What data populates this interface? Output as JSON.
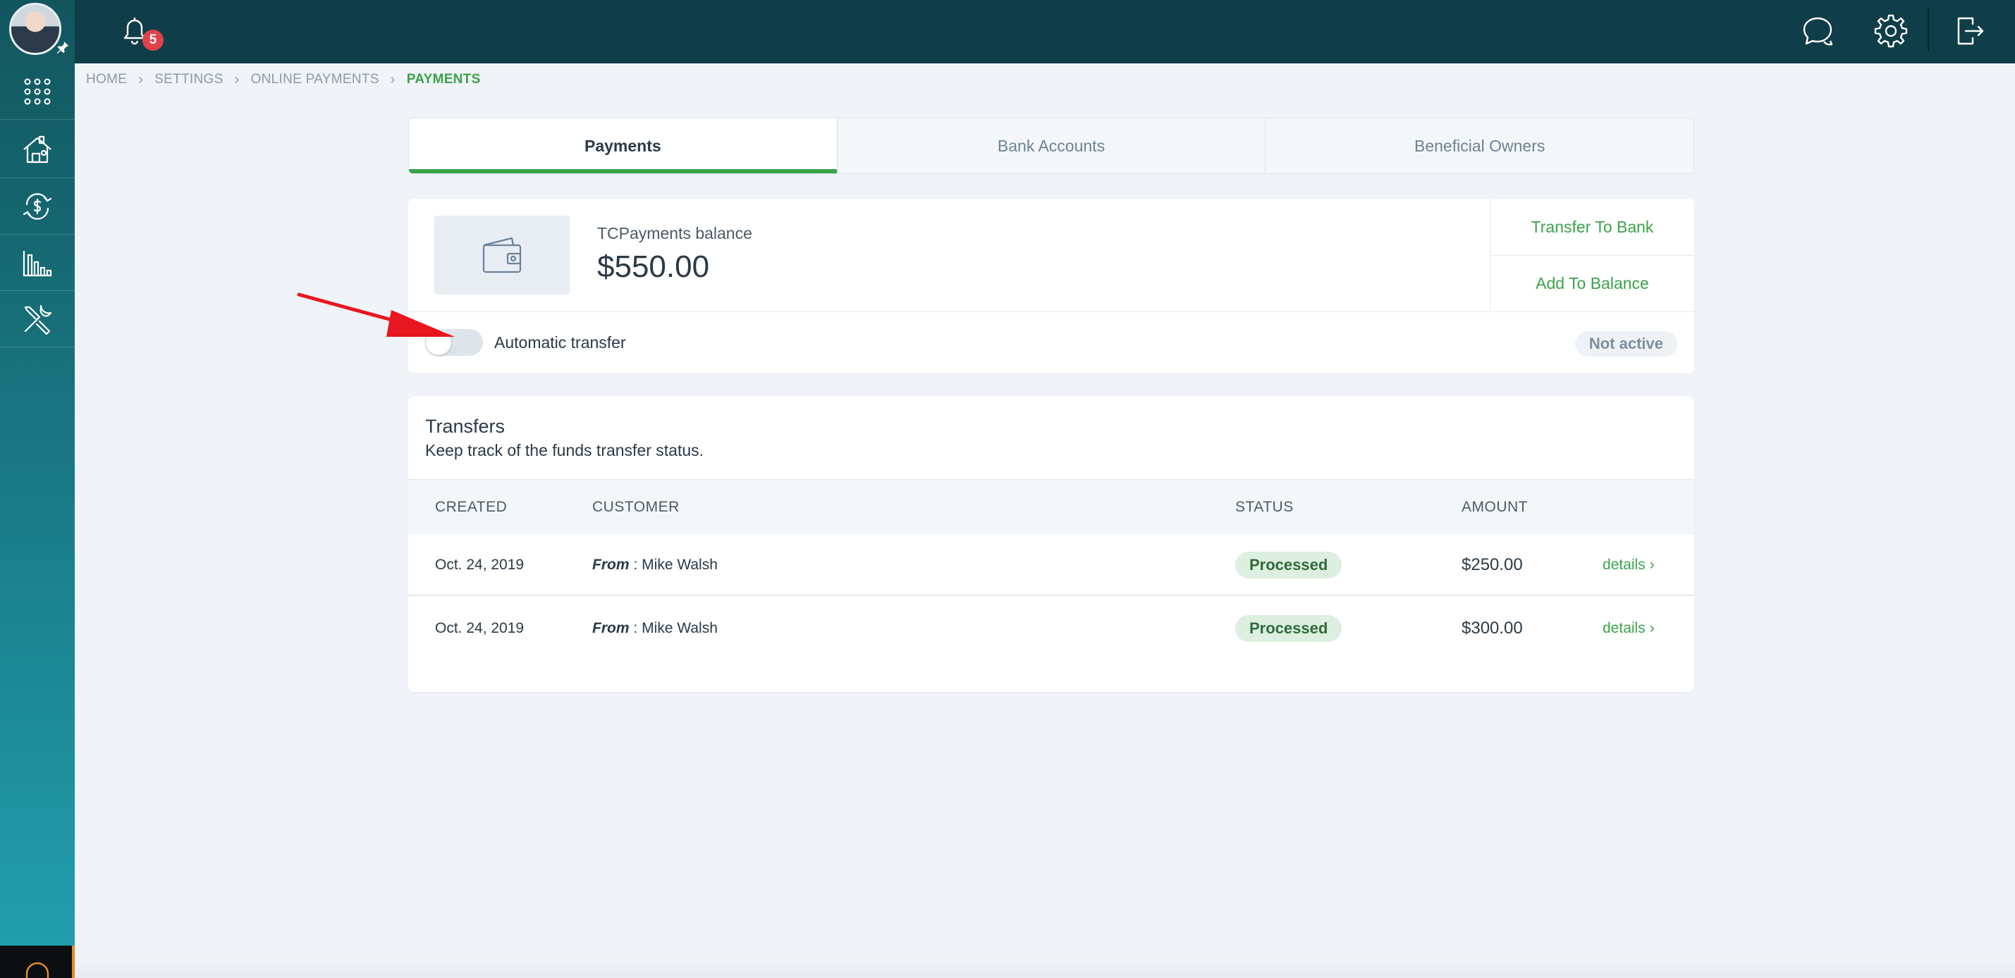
{
  "topbar": {
    "notification_count": "5"
  },
  "breadcrumb": {
    "items": [
      "HOME",
      "SETTINGS",
      "ONLINE PAYMENTS",
      "PAYMENTS"
    ]
  },
  "tabs": [
    {
      "label": "Payments",
      "active": true
    },
    {
      "label": "Bank Accounts",
      "active": false
    },
    {
      "label": "Beneficial Owners",
      "active": false
    }
  ],
  "balance": {
    "label": "TCPayments balance",
    "value": "$550.00",
    "transfer_to_bank": "Transfer To Bank",
    "add_to_balance": "Add To Balance",
    "auto_transfer_label": "Automatic transfer",
    "auto_transfer_enabled": false,
    "status": "Not active"
  },
  "transfers": {
    "title": "Transfers",
    "subtitle": "Keep track of the funds transfer status.",
    "columns": {
      "created": "CREATED",
      "customer": "CUSTOMER",
      "status": "STATUS",
      "amount": "AMOUNT"
    },
    "rows": [
      {
        "created": "Oct. 24, 2019",
        "from_label": "From",
        "customer": ": Mike Walsh",
        "status": "Processed",
        "amount": "$250.00",
        "details": "details"
      },
      {
        "created": "Oct. 24, 2019",
        "from_label": "From",
        "customer": ": Mike Walsh",
        "status": "Processed",
        "amount": "$300.00",
        "details": "details"
      }
    ]
  },
  "colors": {
    "topbar": "#0f3e48",
    "accent_green": "#3aa34a",
    "badge_red": "#e0414b",
    "annotation_arrow": "#e8161e"
  },
  "icons": {
    "sidebar": [
      "apps-grid-icon",
      "home-settings-icon",
      "money-exchange-icon",
      "bar-chart-icon",
      "tools-icon",
      "headset-icon"
    ],
    "topbar": [
      "bell-icon",
      "chat-icon",
      "gear-icon",
      "logout-icon"
    ],
    "balance": "wallet-icon"
  }
}
